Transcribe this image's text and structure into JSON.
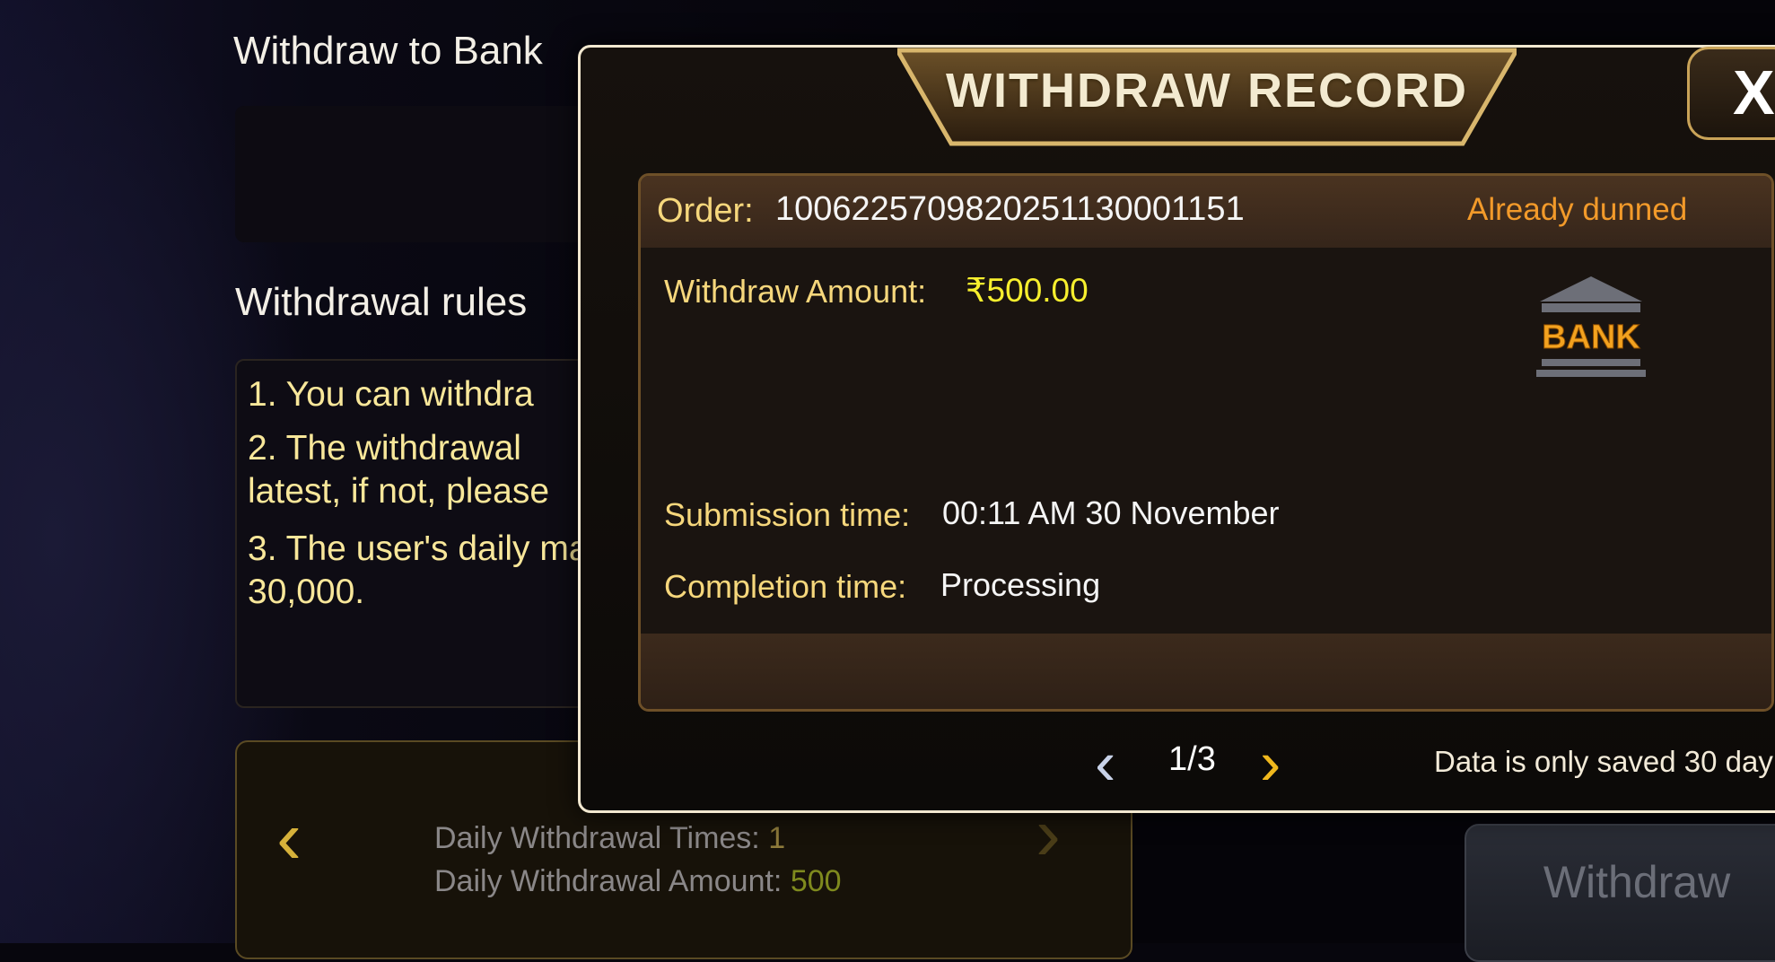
{
  "background": {
    "withdraw_to_bank_label": "Withdraw to Bank",
    "rules_title": "Withdrawal rules",
    "rules": [
      "1. You can withdra",
      "2. The withdrawal",
      "latest, if not, please",
      "3. The user's daily ma",
      "30,000."
    ],
    "limits": {
      "times_label": "Daily Withdrawal Times:",
      "times_value": "1",
      "amount_label": "Daily Withdrawal Amount:",
      "amount_value": "500"
    },
    "withdraw_button": "Withdraw"
  },
  "modal": {
    "title": "WITHDRAW RECORD",
    "close_symbol": "X",
    "record": {
      "order_label": "Order:",
      "order_number": "1006225709820251130001151",
      "status": "Already dunned",
      "amount_label": "Withdraw Amount:",
      "amount_value": "₹500.00",
      "method": "BANK",
      "submission_label": "Submission time:",
      "submission_value": "00:11 AM 30 November",
      "completion_label": "Completion time:",
      "completion_value": "Processing"
    },
    "pager": {
      "prev_symbol": "‹",
      "next_symbol": "›",
      "text": "1/3"
    },
    "note": "Data is only saved 30 day"
  },
  "colors": {
    "accent_gold": "#f6d77c",
    "status_orange": "#f29a2a",
    "amount_yellow": "#f7ef2e"
  },
  "icons": [
    "chevron-left-icon",
    "chevron-right-icon",
    "close-icon",
    "bank-icon"
  ]
}
